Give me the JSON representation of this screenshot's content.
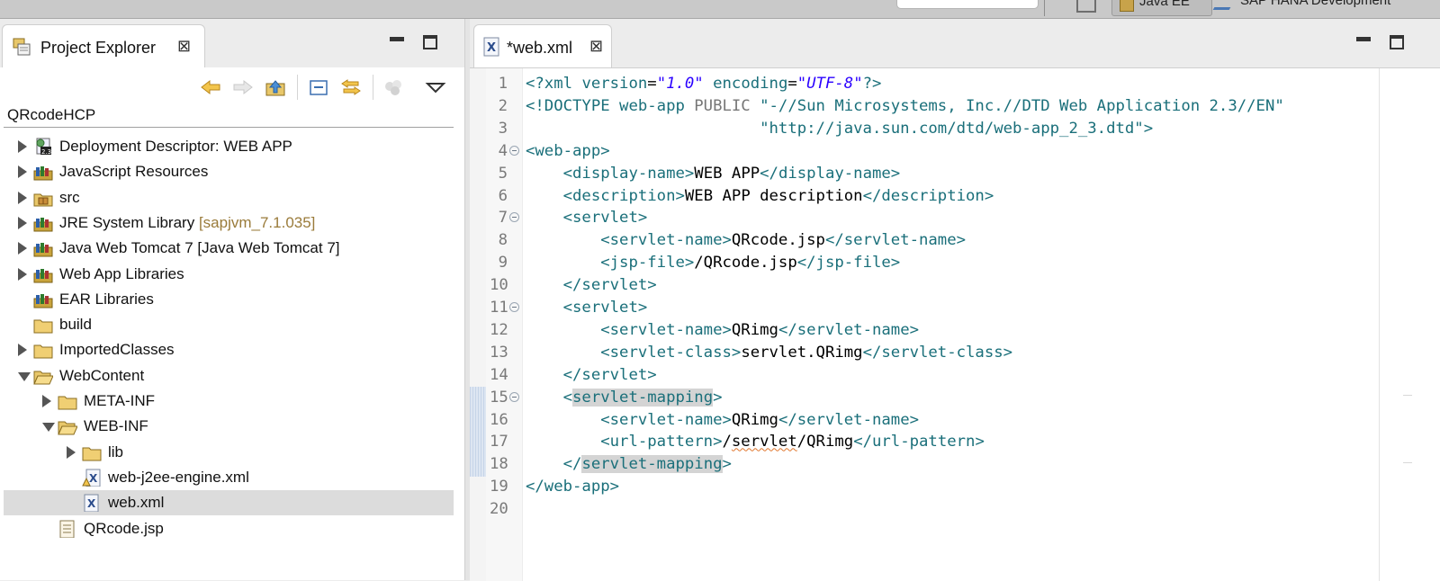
{
  "toolbar": {
    "perspective_active": "Java EE",
    "perspective_other": "SAP HANA Development"
  },
  "project_explorer": {
    "tab_title": "Project Explorer",
    "project": "QRcodeHCP",
    "tree": [
      {
        "label": "Deployment Descriptor: WEB APP",
        "decor": "",
        "depth": 0,
        "twisty": "closed",
        "icon": "deployment-descriptor-icon"
      },
      {
        "label": "JavaScript Resources",
        "decor": "",
        "depth": 0,
        "twisty": "closed",
        "icon": "library-icon"
      },
      {
        "label": "src",
        "decor": "",
        "depth": 0,
        "twisty": "closed",
        "icon": "package-folder-icon"
      },
      {
        "label": "JRE System Library ",
        "decor": "[sapjvm_7.1.035]",
        "depth": 0,
        "twisty": "closed",
        "icon": "library-icon"
      },
      {
        "label": "Java Web Tomcat 7 [Java Web Tomcat 7]",
        "decor": "",
        "depth": 0,
        "twisty": "closed",
        "icon": "library-icon"
      },
      {
        "label": "Web App Libraries",
        "decor": "",
        "depth": 0,
        "twisty": "closed",
        "icon": "library-icon"
      },
      {
        "label": "EAR Libraries",
        "decor": "",
        "depth": 0,
        "twisty": "none",
        "icon": "library-icon"
      },
      {
        "label": "build",
        "decor": "",
        "depth": 0,
        "twisty": "none",
        "icon": "folder-icon"
      },
      {
        "label": "ImportedClasses",
        "decor": "",
        "depth": 0,
        "twisty": "closed",
        "icon": "folder-icon"
      },
      {
        "label": "WebContent",
        "decor": "",
        "depth": 0,
        "twisty": "open",
        "icon": "folder-open-icon"
      },
      {
        "label": "META-INF",
        "decor": "",
        "depth": 1,
        "twisty": "closed",
        "icon": "folder-icon"
      },
      {
        "label": "WEB-INF",
        "decor": "",
        "depth": 1,
        "twisty": "open",
        "icon": "folder-open-icon"
      },
      {
        "label": "lib",
        "decor": "",
        "depth": 2,
        "twisty": "closed",
        "icon": "folder-icon"
      },
      {
        "label": "web-j2ee-engine.xml",
        "decor": "",
        "depth": 2,
        "twisty": "none",
        "icon": "xml-file-warning-icon"
      },
      {
        "label": "web.xml",
        "decor": "",
        "depth": 2,
        "twisty": "none",
        "icon": "xml-file-icon",
        "selected": true
      },
      {
        "label": "QRcode.jsp",
        "decor": "",
        "depth": 1,
        "twisty": "none",
        "icon": "jsp-file-icon"
      }
    ]
  },
  "editor": {
    "tab_title": "*web.xml",
    "lines": [
      {
        "n": "1",
        "fold": false,
        "html": "<span class=\"pi\">&lt;?xml</span> <span class=\"pi\">version</span>=<span class=\"str\">\"1.0\"</span> <span class=\"pi\">encoding</span>=<span class=\"str\">\"UTF-8\"</span><span class=\"pi\">?&gt;</span>"
      },
      {
        "n": "2",
        "fold": false,
        "html": "<span class=\"tag\">&lt;!DOCTYPE web-app</span> <span class=\"kw\">PUBLIC</span> <span class=\"dstr\">\"-//Sun Microsystems, Inc.//DTD Web Application 2.3//EN\"</span>"
      },
      {
        "n": "3",
        "fold": false,
        "html": "                         <span class=\"dstr\">\"http://java.sun.com/dtd/web-app_2_3.dtd\"</span><span class=\"tag\">&gt;</span>"
      },
      {
        "n": "4",
        "fold": true,
        "html": "<span class=\"tag\">&lt;web-app&gt;</span>"
      },
      {
        "n": "5",
        "fold": false,
        "html": "    <span class=\"tag\">&lt;display-name&gt;</span>WEB APP<span class=\"tag\">&lt;/display-name&gt;</span>"
      },
      {
        "n": "6",
        "fold": false,
        "html": "    <span class=\"tag\">&lt;description&gt;</span>WEB APP description<span class=\"tag\">&lt;/description&gt;</span>"
      },
      {
        "n": "7",
        "fold": true,
        "html": "    <span class=\"tag\">&lt;servlet&gt;</span>"
      },
      {
        "n": "8",
        "fold": false,
        "html": "        <span class=\"tag\">&lt;servlet-name&gt;</span>QRcode.jsp<span class=\"tag\">&lt;/servlet-name&gt;</span>"
      },
      {
        "n": "9",
        "fold": false,
        "html": "        <span class=\"tag\">&lt;jsp-file&gt;</span>/QRcode.jsp<span class=\"tag\">&lt;/jsp-file&gt;</span>"
      },
      {
        "n": "10",
        "fold": false,
        "html": "    <span class=\"tag\">&lt;/servlet&gt;</span>"
      },
      {
        "n": "11",
        "fold": true,
        "html": "    <span class=\"tag\">&lt;servlet&gt;</span>"
      },
      {
        "n": "12",
        "fold": false,
        "html": "        <span class=\"tag\">&lt;servlet-name&gt;</span>QRimg<span class=\"tag\">&lt;/servlet-name&gt;</span>"
      },
      {
        "n": "13",
        "fold": false,
        "html": "        <span class=\"tag\">&lt;servlet-class&gt;</span>servlet.QRimg<span class=\"tag\">&lt;/servlet-class&gt;</span>"
      },
      {
        "n": "14",
        "fold": false,
        "html": "    <span class=\"tag\">&lt;/servlet&gt;</span>"
      },
      {
        "n": "15",
        "fold": true,
        "html": "    <span class=\"tag\">&lt;<span class=\"hl\">servlet-mapping</span>&gt;</span>"
      },
      {
        "n": "16",
        "fold": false,
        "html": "        <span class=\"tag\">&lt;servlet-name&gt;</span>QRimg<span class=\"tag\">&lt;/servlet-name&gt;</span>"
      },
      {
        "n": "17",
        "fold": false,
        "html": "        <span class=\"tag\">&lt;url-pattern&gt;</span>/<span class=\"squig\">servlet</span>/QRimg<span class=\"tag\">&lt;/url-pattern&gt;</span>"
      },
      {
        "n": "18",
        "fold": false,
        "html": "    <span class=\"tag\">&lt;/<span class=\"hl\">servlet-mapping</span>&gt;</span>"
      },
      {
        "n": "19",
        "fold": false,
        "html": "<span class=\"tag\">&lt;/web-app&gt;</span>"
      },
      {
        "n": "20",
        "fold": false,
        "html": ""
      }
    ]
  }
}
